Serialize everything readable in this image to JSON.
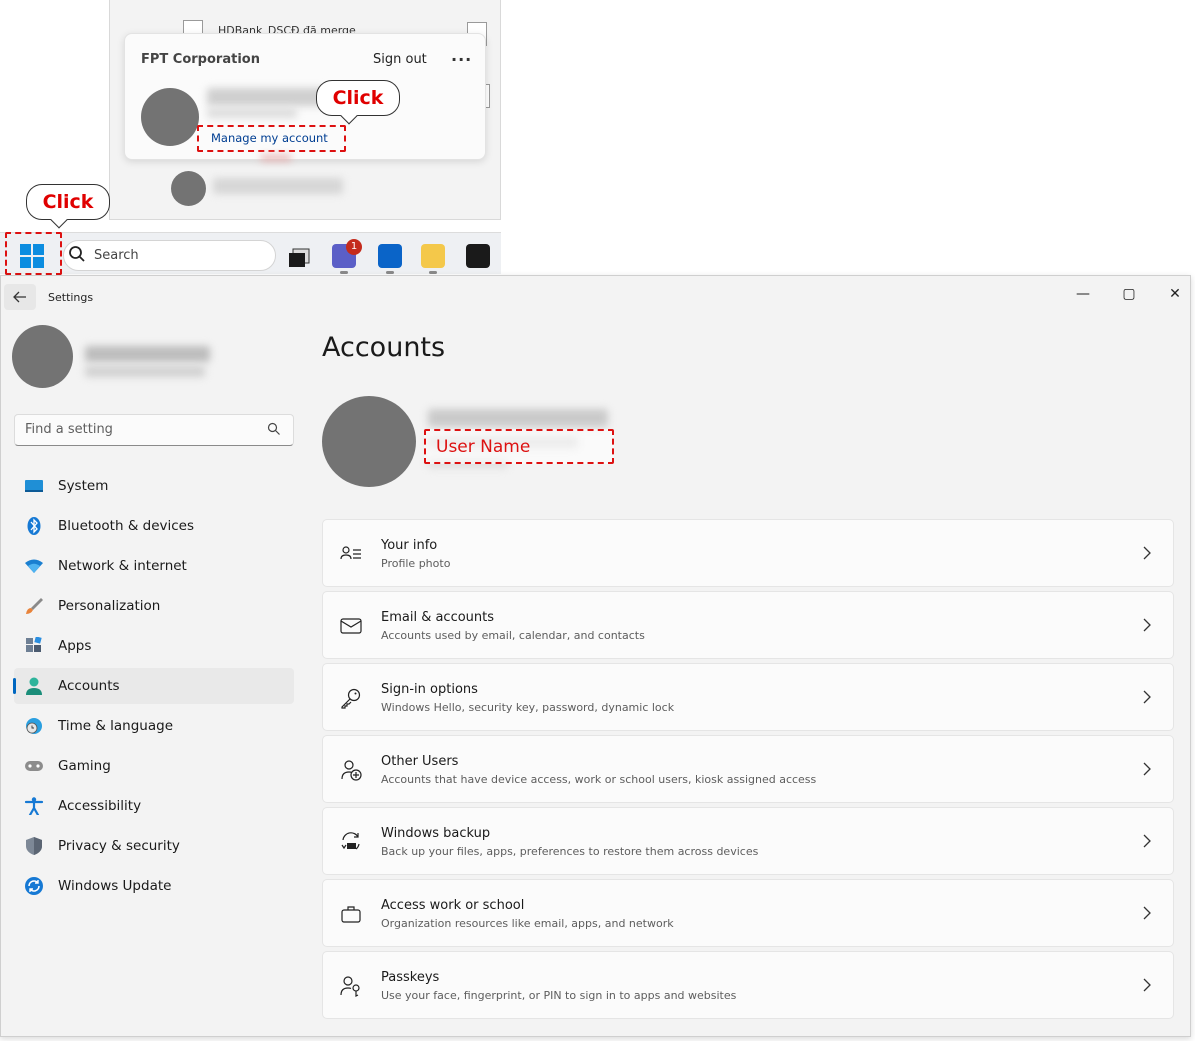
{
  "start_menu": {
    "doc_title": "HDBank_DSCĐ đã merge",
    "org_name": "FPT Corporation",
    "signout_label": "Sign out",
    "more_label": "···",
    "manage_account_link": "Manage my account"
  },
  "callouts": {
    "top": "Click",
    "start": "Click"
  },
  "taskbar": {
    "search_label": "Search",
    "teams_badge": "1"
  },
  "window": {
    "title": "Settings",
    "minimize_glyph": "—",
    "maximize_glyph": "▢",
    "close_glyph": "✕"
  },
  "sidebar": {
    "search_placeholder": "Find a setting",
    "items": [
      {
        "label": "System",
        "icon": "display-icon"
      },
      {
        "label": "Bluetooth & devices",
        "icon": "bluetooth-icon"
      },
      {
        "label": "Network & internet",
        "icon": "wifi-icon"
      },
      {
        "label": "Personalization",
        "icon": "brush-icon"
      },
      {
        "label": "Apps",
        "icon": "apps-icon"
      },
      {
        "label": "Accounts",
        "icon": "person-icon"
      },
      {
        "label": "Time & language",
        "icon": "globe-clock-icon"
      },
      {
        "label": "Gaming",
        "icon": "gamepad-icon"
      },
      {
        "label": "Accessibility",
        "icon": "accessibility-icon"
      },
      {
        "label": "Privacy & security",
        "icon": "shield-icon"
      },
      {
        "label": "Windows Update",
        "icon": "update-icon"
      }
    ],
    "selected": "Accounts"
  },
  "main": {
    "title": "Accounts",
    "username_annotation": "User Name",
    "cards": [
      {
        "title": "Your info",
        "subtitle": "Profile photo",
        "icon": "person-card-icon"
      },
      {
        "title": "Email & accounts",
        "subtitle": "Accounts used by email, calendar, and contacts",
        "icon": "mail-icon"
      },
      {
        "title": "Sign-in options",
        "subtitle": "Windows Hello, security key, password, dynamic lock",
        "icon": "key-icon"
      },
      {
        "title": "Other Users",
        "subtitle": "Accounts that have device access, work or school users, kiosk assigned access",
        "icon": "add-user-icon"
      },
      {
        "title": "Windows backup",
        "subtitle": "Back up your files, apps, preferences to restore them across devices",
        "icon": "backup-icon"
      },
      {
        "title": "Access work or school",
        "subtitle": "Organization resources like email, apps, and network",
        "icon": "briefcase-icon"
      },
      {
        "title": "Passkeys",
        "subtitle": "Use your face, fingerprint, or PIN to sign in to apps and websites",
        "icon": "passkey-icon"
      }
    ]
  },
  "colors": {
    "accent": "#0067c0",
    "annotation_red": "#dd1111",
    "avatar_gray": "#737373",
    "window_bg": "#f3f3f3",
    "card_bg": "#fbfbfb"
  }
}
